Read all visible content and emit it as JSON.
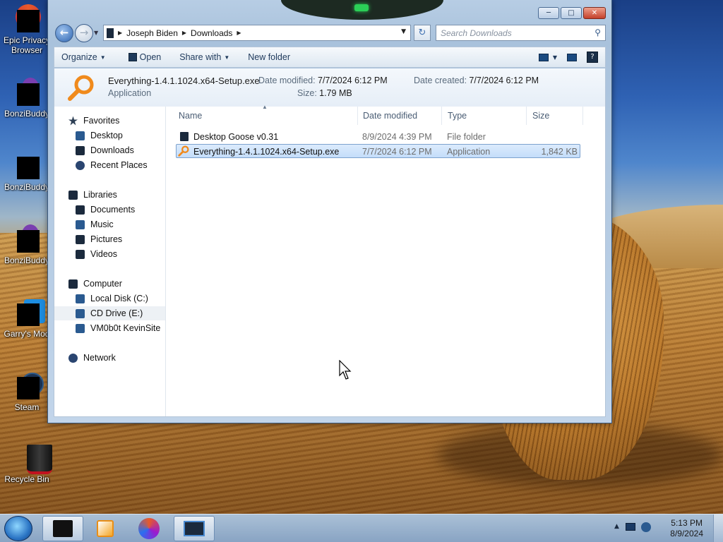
{
  "desktop": {
    "icons": [
      {
        "label": "Epic Privacy Browser",
        "icon": "epic-browser-icon"
      },
      {
        "label": "BonziBuddy",
        "icon": "bonzibuddy-icon"
      },
      {
        "label": "BonziBuddy",
        "icon": "bonzibuddy-icon"
      },
      {
        "label": "BonziBuddy",
        "icon": "bonzibuddy-icon"
      },
      {
        "label": "Garry's Mod",
        "icon": "garrys-mod-icon"
      },
      {
        "label": "Steam",
        "icon": "steam-icon"
      },
      {
        "label": "Recycle Bin",
        "icon": "recycle-bin-icon"
      }
    ]
  },
  "window": {
    "breadcrumb": [
      "Joseph Biden",
      "Downloads"
    ],
    "search_placeholder": "Search Downloads",
    "toolbar": {
      "organize": "Organize",
      "open": "Open",
      "share_with": "Share with",
      "new_folder": "New folder"
    },
    "details": {
      "name": "Everything-1.4.1.1024.x64-Setup.exe",
      "type": "Application",
      "date_modified_label": "Date modified:",
      "date_modified": "7/7/2024 6:12 PM",
      "size_label": "Size:",
      "size": "1.79 MB",
      "date_created_label": "Date created:",
      "date_created": "7/7/2024 6:12 PM"
    },
    "nav": {
      "favorites": "Favorites",
      "desktop": "Desktop",
      "downloads": "Downloads",
      "recent_places": "Recent Places",
      "libraries": "Libraries",
      "documents": "Documents",
      "music": "Music",
      "pictures": "Pictures",
      "videos": "Videos",
      "computer": "Computer",
      "local_disk": "Local Disk (C:)",
      "cd_drive": "CD Drive (E:)",
      "share": "VM0b0t KevinSite",
      "network": "Network"
    },
    "columns": {
      "name": "Name",
      "date_modified": "Date modified",
      "type": "Type",
      "size": "Size"
    },
    "files": [
      {
        "name": "Desktop Goose v0.31",
        "date": "8/9/2024 4:39 PM",
        "type": "File folder",
        "size": ""
      },
      {
        "name": "Everything-1.4.1.1024.x64-Setup.exe",
        "date": "7/7/2024 6:12 PM",
        "type": "Application",
        "size": "1,842 KB"
      }
    ]
  },
  "taskbar": {
    "time": "5:13 PM",
    "date": "8/9/2024"
  },
  "colors": {
    "selection": "#cce0f8",
    "window_frame": "#b7cde4"
  }
}
